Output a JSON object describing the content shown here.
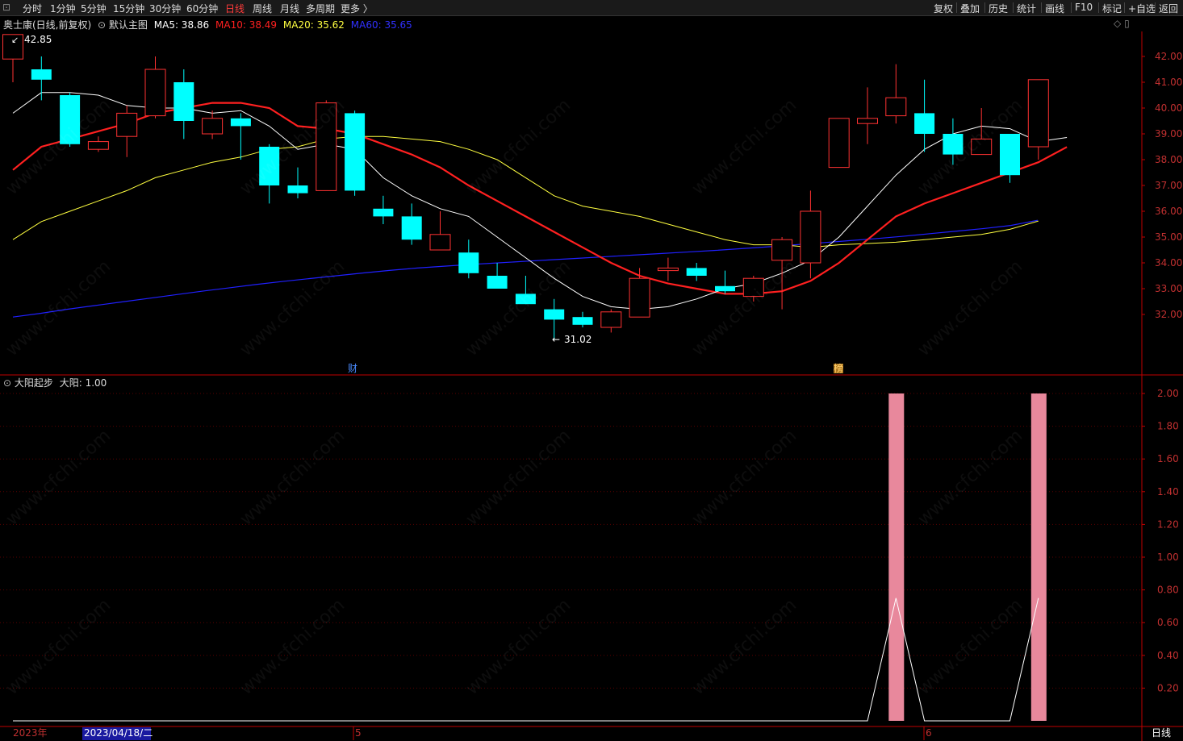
{
  "toolbar": {
    "left_items": [
      "分时",
      "1分钟",
      "5分钟",
      "15分钟",
      "30分钟",
      "60分钟",
      "日线",
      "周线",
      "月线",
      "多周期",
      "更多 〉"
    ],
    "active": "日线",
    "right_items": [
      "复权",
      "叠加",
      "历史",
      "统计",
      "画线",
      "F10",
      "标记",
      "+自选",
      "返回"
    ]
  },
  "main_legend": {
    "stock": "奥士康(日线,前复权)",
    "template": "默认主图",
    "ma5": "MA5: 38.86",
    "ma10": "MA10: 38.49",
    "ma20": "MA20: 35.62",
    "ma60": "MA60: 35.65"
  },
  "sub_legend": {
    "indicator": "大阳起步",
    "value": "大阳: 1.00"
  },
  "annotations": {
    "high": "42.85",
    "low": "31.02",
    "marker_cai": "财",
    "marker_bang": "榜"
  },
  "x_axis": {
    "year": "2023年",
    "cursor_date": "2023/04/18/二",
    "m5": "5",
    "m6": "6",
    "period": "日线"
  },
  "watermark": "www.cfchi.com",
  "colors": {
    "up": "#ff3232",
    "down": "#00ffff",
    "ma5": "#ffffff",
    "ma10": "#ff2020",
    "ma20": "#ffff40",
    "ma60": "#2020ff",
    "signal_bar": "#e8889c",
    "axis": "#c00000"
  },
  "chart_data": {
    "type": "candlestick",
    "y_ticks": [
      "42.00",
      "41.00",
      "40.00",
      "39.00",
      "38.00",
      "37.00",
      "36.00",
      "35.00",
      "34.00",
      "33.00",
      "32.00"
    ],
    "ylim": [
      30.5,
      43.2
    ],
    "candles": [
      {
        "o": 41.9,
        "h": 42.85,
        "l": 41.0,
        "c": 42.85
      },
      {
        "o": 41.5,
        "h": 42.0,
        "l": 40.3,
        "c": 41.1
      },
      {
        "o": 40.5,
        "h": 40.6,
        "l": 38.5,
        "c": 38.6
      },
      {
        "o": 38.4,
        "h": 38.9,
        "l": 38.3,
        "c": 38.7
      },
      {
        "o": 38.9,
        "h": 40.1,
        "l": 38.1,
        "c": 39.8
      },
      {
        "o": 39.7,
        "h": 42.0,
        "l": 39.6,
        "c": 41.5
      },
      {
        "o": 41.0,
        "h": 41.5,
        "l": 38.8,
        "c": 39.5
      },
      {
        "o": 39.0,
        "h": 39.9,
        "l": 38.8,
        "c": 39.6
      },
      {
        "o": 39.6,
        "h": 39.8,
        "l": 38.0,
        "c": 39.3
      },
      {
        "o": 38.5,
        "h": 38.6,
        "l": 36.3,
        "c": 37.0
      },
      {
        "o": 37.0,
        "h": 37.7,
        "l": 36.5,
        "c": 36.7
      },
      {
        "o": 36.8,
        "h": 40.3,
        "l": 36.8,
        "c": 40.2
      },
      {
        "o": 39.8,
        "h": 39.9,
        "l": 36.6,
        "c": 36.8
      },
      {
        "o": 36.1,
        "h": 36.6,
        "l": 35.5,
        "c": 35.8
      },
      {
        "o": 35.8,
        "h": 36.3,
        "l": 34.7,
        "c": 34.9
      },
      {
        "o": 34.5,
        "h": 36.0,
        "l": 34.5,
        "c": 35.1
      },
      {
        "o": 34.4,
        "h": 34.9,
        "l": 33.4,
        "c": 33.6
      },
      {
        "o": 33.5,
        "h": 34.0,
        "l": 33.0,
        "c": 33.0
      },
      {
        "o": 32.8,
        "h": 33.5,
        "l": 32.4,
        "c": 32.4
      },
      {
        "o": 32.2,
        "h": 32.6,
        "l": 31.02,
        "c": 31.8
      },
      {
        "o": 31.9,
        "h": 32.1,
        "l": 31.5,
        "c": 31.6
      },
      {
        "o": 31.5,
        "h": 32.2,
        "l": 31.3,
        "c": 32.1
      },
      {
        "o": 31.9,
        "h": 33.8,
        "l": 31.9,
        "c": 33.4
      },
      {
        "o": 33.7,
        "h": 34.2,
        "l": 33.3,
        "c": 33.8
      },
      {
        "o": 33.8,
        "h": 34.0,
        "l": 33.3,
        "c": 33.5
      },
      {
        "o": 33.1,
        "h": 33.7,
        "l": 32.8,
        "c": 32.9
      },
      {
        "o": 32.7,
        "h": 33.5,
        "l": 32.5,
        "c": 33.4
      },
      {
        "o": 34.1,
        "h": 35.0,
        "l": 32.2,
        "c": 34.9
      },
      {
        "o": 34.0,
        "h": 36.8,
        "l": 33.4,
        "c": 36.0
      },
      {
        "o": 37.7,
        "h": 39.6,
        "l": 37.7,
        "c": 39.6
      },
      {
        "o": 39.4,
        "h": 40.8,
        "l": 38.6,
        "c": 39.6
      },
      {
        "o": 39.7,
        "h": 41.7,
        "l": 39.4,
        "c": 40.4
      },
      {
        "o": 39.8,
        "h": 41.1,
        "l": 38.3,
        "c": 39.0
      },
      {
        "o": 39.0,
        "h": 39.6,
        "l": 37.8,
        "c": 38.2
      },
      {
        "o": 38.2,
        "h": 40.0,
        "l": 38.2,
        "c": 38.8
      },
      {
        "o": 39.0,
        "h": 39.0,
        "l": 37.1,
        "c": 37.4
      },
      {
        "o": 38.5,
        "h": 41.1,
        "l": 38.0,
        "c": 41.1
      }
    ],
    "ma5": [
      39.8,
      40.6,
      40.6,
      40.5,
      40.1,
      40.0,
      40.0,
      39.8,
      39.9,
      39.3,
      38.4,
      38.6,
      38.4,
      37.3,
      36.6,
      36.1,
      35.8,
      35.0,
      34.2,
      33.4,
      32.7,
      32.3,
      32.2,
      32.3,
      32.6,
      33.0,
      33.2,
      33.6,
      34.1,
      35.0,
      36.2,
      37.4,
      38.4,
      39.0,
      39.3,
      39.2,
      38.7,
      38.86
    ],
    "ma10": [
      37.6,
      38.5,
      38.8,
      39.1,
      39.4,
      39.8,
      40.0,
      40.2,
      40.2,
      40.0,
      39.3,
      39.2,
      39.0,
      38.6,
      38.2,
      37.7,
      37.0,
      36.4,
      35.8,
      35.2,
      34.6,
      34.0,
      33.5,
      33.2,
      33.0,
      32.8,
      32.8,
      32.9,
      33.3,
      34.0,
      34.9,
      35.8,
      36.3,
      36.7,
      37.1,
      37.5,
      37.9,
      38.49
    ],
    "ma20": [
      34.9,
      35.6,
      36.0,
      36.4,
      36.8,
      37.3,
      37.6,
      37.9,
      38.1,
      38.4,
      38.5,
      38.8,
      38.9,
      38.9,
      38.8,
      38.7,
      38.4,
      38.0,
      37.3,
      36.6,
      36.2,
      36.0,
      35.8,
      35.5,
      35.2,
      34.9,
      34.7,
      34.7,
      34.6,
      34.7,
      34.75,
      34.8,
      34.9,
      35.0,
      35.1,
      35.3,
      35.62
    ],
    "ma60": [
      31.9,
      32.04,
      32.2,
      32.34,
      32.48,
      32.62,
      32.76,
      32.9,
      33.03,
      33.16,
      33.28,
      33.39,
      33.5,
      33.61,
      33.71,
      33.8,
      33.87,
      33.94,
      34.0,
      34.06,
      34.12,
      34.18,
      34.24,
      34.3,
      34.36,
      34.42,
      34.48,
      34.55,
      34.62,
      34.7,
      34.78,
      34.86,
      34.94,
      35.03,
      35.13,
      35.23,
      35.33,
      35.45,
      35.65
    ],
    "indicator": {
      "name": "大阳",
      "y_ticks": [
        "2.00",
        "1.80",
        "1.60",
        "1.40",
        "1.20",
        "1.00",
        "0.80",
        "0.60",
        "0.40",
        "0.20"
      ],
      "ylim": [
        0,
        2.04
      ],
      "values": [
        0,
        0,
        0,
        0,
        0,
        0,
        0,
        0,
        0,
        0,
        0,
        0,
        0,
        0,
        0,
        0,
        0,
        0,
        0,
        0,
        0,
        0,
        0,
        0,
        0,
        0,
        0,
        0,
        0,
        0,
        0,
        2,
        0,
        0,
        0,
        0,
        2
      ],
      "line": [
        0,
        0,
        0,
        0,
        0,
        0,
        0,
        0,
        0,
        0,
        0,
        0,
        0,
        0,
        0,
        0,
        0,
        0,
        0,
        0,
        0,
        0,
        0,
        0,
        0,
        0,
        0,
        0,
        0,
        0,
        0,
        0.75,
        0,
        0,
        0,
        0,
        0.75
      ]
    }
  }
}
